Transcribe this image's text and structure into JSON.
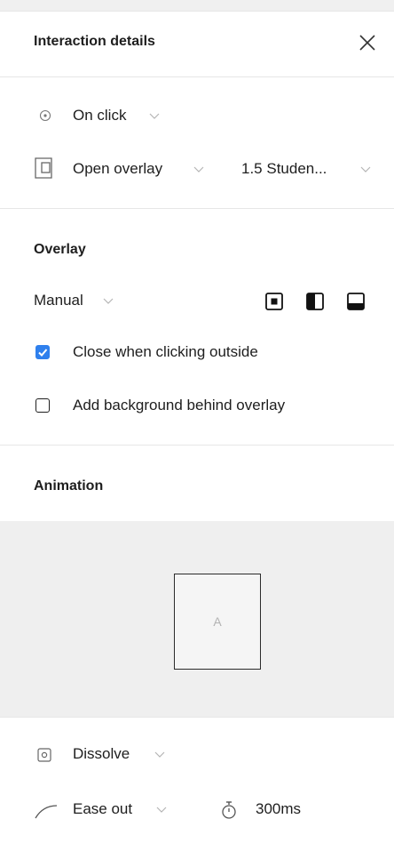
{
  "header": {
    "title": "Interaction details"
  },
  "trigger": {
    "label": "On click"
  },
  "action": {
    "label": "Open overlay",
    "destination": "1.5 Studen..."
  },
  "overlay": {
    "section_title": "Overlay",
    "position": "Manual",
    "close_outside": {
      "label": "Close when clicking outside",
      "checked": true
    },
    "add_background": {
      "label": "Add background behind overlay",
      "checked": false
    }
  },
  "animation": {
    "section_title": "Animation",
    "preview_label": "A",
    "type": "Dissolve",
    "easing": "Ease out",
    "duration": "300ms"
  },
  "colors": {
    "accent": "#2f80ed",
    "text": "#1e1e1e",
    "preview_bg": "#efefef"
  }
}
